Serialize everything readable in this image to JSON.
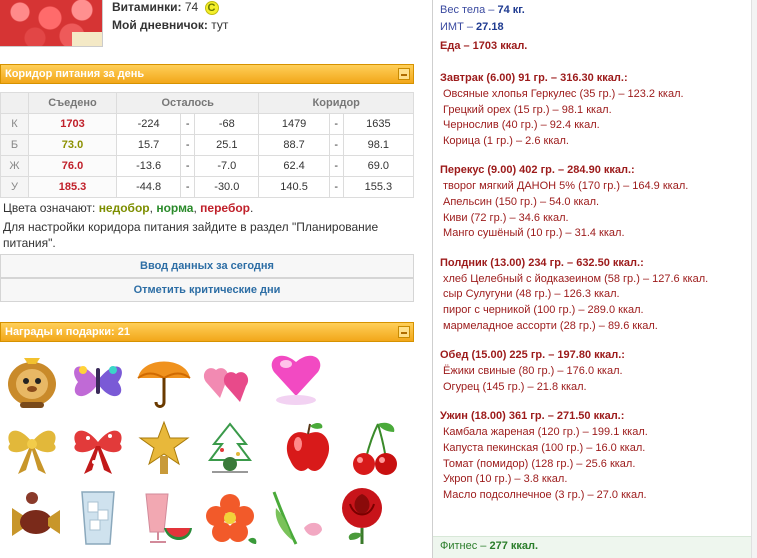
{
  "profile": {
    "vitamins_label": "Витаминки:",
    "vitamins_value": "74",
    "vitamins_badge": "C",
    "diary_label": "Мой дневничок:",
    "diary_value": "тут"
  },
  "corridor_panel": {
    "title": "Коридор питания за день",
    "headers": [
      "Съедено",
      "Осталось",
      "Коридор"
    ],
    "rows": [
      {
        "label": "К",
        "eaten": "1703",
        "left_min": "-224",
        "left_max": "-68",
        "corr_min": "1479",
        "corr_max": "1635",
        "color": "#c0202a"
      },
      {
        "label": "Б",
        "eaten": "73.0",
        "left_min": "15.7",
        "left_max": "25.1",
        "corr_min": "88.7",
        "corr_max": "98.1",
        "color": "#8c9000"
      },
      {
        "label": "Ж",
        "eaten": "76.0",
        "left_min": "-13.6",
        "left_max": "-7.0",
        "corr_min": "62.4",
        "corr_max": "69.0",
        "color": "#c0202a"
      },
      {
        "label": "У",
        "eaten": "185.3",
        "left_min": "-44.8",
        "left_max": "-30.0",
        "corr_min": "140.5",
        "corr_max": "155.3",
        "color": "#c0202a"
      }
    ],
    "dash": "-",
    "legend_prefix": "Цвета означают:",
    "legend_under": "недобор",
    "legend_sep": ",",
    "legend_norm": "норма",
    "legend_over": "перебор",
    "legend_end": ".",
    "hint": "Для настройки коридора питания зайдите в раздел \"Планирование питания\".",
    "btn_enter": "Ввод данных за сегодня",
    "btn_critical": "Отметить критические дни"
  },
  "gifts_panel": {
    "title": "Награды и подарки: 21",
    "items": [
      "lion-toy",
      "butterfly",
      "umbrella",
      "two-hearts",
      "pink-heart",
      "gold-bow",
      "red-bow",
      "gold-star",
      "christmas-tree",
      "red-apple",
      "cherries",
      "candy",
      "ice-glass",
      "watermelon-drink",
      "flower",
      "tulip",
      "red-rose"
    ]
  },
  "diary": {
    "weight_label": "Вес тела –",
    "weight_value": "74 кг.",
    "bmi_label": "ИМТ –",
    "bmi_value": "27.18",
    "food_total": "Еда – 1703 ккал.",
    "meals": [
      {
        "title": "Завтрак (6.00) 91 гр. – 316.30 ккал.:",
        "items": [
          "Овсяные хлопья Геркулес (35 гр.) – 123.2 ккал.",
          "Грецкий орех (15 гр.) – 98.1 ккал.",
          "Чернослив (40 гр.) – 92.4 ккал.",
          "Корица (1 гр.) – 2.6 ккал."
        ]
      },
      {
        "title": "Перекус (9.00) 402 гр. – 284.90 ккал.:",
        "items": [
          "творог мягкий ДАНОН 5% (170 гр.) – 164.9 ккал.",
          "Апельсин (150 гр.) – 54.0 ккал.",
          "Киви (72 гр.) – 34.6 ккал.",
          "Манго сушёный (10 гр.) – 31.4 ккал."
        ]
      },
      {
        "title": "Полдник (13.00) 234 гр. – 632.50 ккал.:",
        "items": [
          "хлеб Целебный с йодказеином (58 гр.) – 127.6 ккал.",
          "сыр Сулугуни (48 гр.) – 126.3 ккал.",
          "пирог с черникой (100 гр.) – 289.0 ккал.",
          "мармеладное ассорти (28 гр.) – 89.6 ккал."
        ]
      },
      {
        "title": "Обед (15.00) 225 гр. – 197.80 ккал.:",
        "items": [
          "Ёжики свиные (80 гр.) – 176.0 ккал.",
          "Огурец (145 гр.) – 21.8 ккал."
        ]
      },
      {
        "title": "Ужин (18.00) 361 гр. – 271.50 ккал.:",
        "items": [
          "Камбала жареная (120 гр.) – 199.1 ккал.",
          "Капуста пекинская (100 гр.) – 16.0 ккал.",
          "Томат (помидор) (128 гр.) – 25.6 ккал.",
          "Укроп (10 гр.) – 3.8 ккал.",
          "Масло подсолнечное (3 гр.) – 27.0 ккал."
        ]
      }
    ],
    "fitness_label": "Фитнес –",
    "fitness_value": "277 ккал."
  }
}
